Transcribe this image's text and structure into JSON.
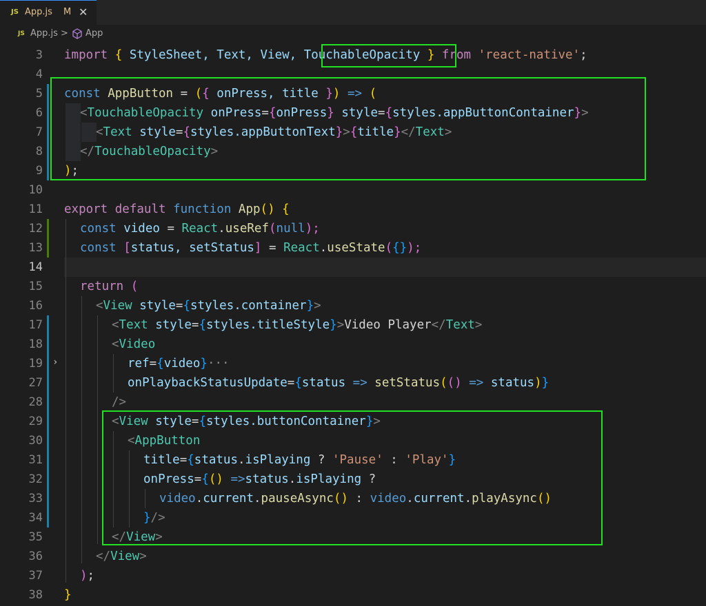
{
  "tab": {
    "icon": "JS",
    "name": "App.js",
    "status": "M",
    "close": "✕"
  },
  "breadcrumb": {
    "icon": "JS",
    "file": "App.js",
    "sep": ">",
    "symbol_icon": "cube-icon",
    "symbol": "App"
  },
  "line_numbers": [
    "3",
    "4",
    "5",
    "6",
    "7",
    "8",
    "9",
    "10",
    "11",
    "12",
    "13",
    "14",
    "15",
    "16",
    "17",
    "18",
    "19",
    "27",
    "28",
    "29",
    "30",
    "31",
    "32",
    "33",
    "34",
    "35",
    "36",
    "37",
    "38"
  ],
  "active_line": "14",
  "code": {
    "l3": [
      "import",
      " ",
      "{",
      " StyleSheet, Text, View, ",
      "TouchableOpacity",
      " ",
      "}",
      " from ",
      "'react-native'",
      ";"
    ],
    "l5": [
      "const",
      " AppButton ",
      "= ",
      "(",
      "{",
      " onPress, title ",
      "}",
      ") ",
      "=>",
      " ",
      "("
    ],
    "l6": [
      "<",
      "TouchableOpacity",
      " onPress",
      "=",
      "{",
      "onPress",
      "}",
      " style",
      "=",
      "{",
      "styles",
      ".appButtonContainer",
      "}",
      ">"
    ],
    "l7": [
      "<",
      "Text",
      " style",
      "=",
      "{",
      "styles",
      ".appButtonText",
      "}",
      ">",
      "{",
      "title",
      "}",
      "</",
      "Text",
      ">"
    ],
    "l8": [
      "</",
      "TouchableOpacity",
      ">"
    ],
    "l9": [
      ")",
      ";"
    ],
    "l11": [
      "export",
      " ",
      "default",
      " ",
      "function",
      " ",
      "App",
      "() ",
      "{"
    ],
    "l12": [
      "const",
      " video ",
      "= ",
      "React",
      ".",
      "useRef",
      "(",
      "null",
      ");"
    ],
    "l13": [
      "const",
      " ",
      "[",
      "status, setStatus",
      "]",
      " = ",
      "React",
      ".",
      "useState",
      "(",
      "{}",
      ");"
    ],
    "l15": [
      "return",
      " ",
      "("
    ],
    "l16": [
      "<",
      "View",
      " style",
      "=",
      "{",
      "styles",
      ".container",
      "}",
      ">"
    ],
    "l17": [
      "<",
      "Text",
      " style",
      "=",
      "{",
      "styles",
      ".titleStyle",
      "}",
      ">",
      "Video Player",
      "</",
      "Text",
      ">"
    ],
    "l18": [
      "<",
      "Video"
    ],
    "l19": [
      "ref",
      "=",
      "{",
      "video",
      "}",
      "···"
    ],
    "l27": [
      "onPlaybackStatusUpdate",
      "=",
      "{",
      "status ",
      "=>",
      " ",
      "setStatus",
      "(",
      "() ",
      "=>",
      " status",
      ")",
      "}"
    ],
    "l28": [
      "/>"
    ],
    "l29": [
      "<",
      "View",
      " style",
      "=",
      "{",
      "styles",
      ".buttonContainer",
      "}",
      ">"
    ],
    "l30": [
      "<",
      "AppButton"
    ],
    "l31": [
      "title",
      "=",
      "{",
      "status",
      ".",
      "isPlaying",
      " ? ",
      "'Pause'",
      " : ",
      "'Play'",
      "}"
    ],
    "l32": [
      "onPress",
      "=",
      "{",
      "() ",
      "=>",
      "status",
      ".",
      "isPlaying",
      " ?"
    ],
    "l33": [
      "video",
      ".",
      "current",
      ".",
      "pauseAsync",
      "()",
      " : ",
      "video",
      ".",
      "current",
      ".",
      "playAsync",
      "()"
    ],
    "l34": [
      "}",
      "/>"
    ],
    "l35": [
      "</",
      "View",
      ">"
    ],
    "l36": [
      "</",
      "View",
      ">"
    ],
    "l37": [
      ")",
      ";"
    ],
    "l38": [
      "}"
    ]
  },
  "fold_marker": "›",
  "colors": {
    "highlight_box": "#22e022",
    "background": "#1e1e1e",
    "keyword": "#c586c0",
    "storage": "#569cd6",
    "component": "#4ec9b0",
    "string": "#ce9178"
  }
}
